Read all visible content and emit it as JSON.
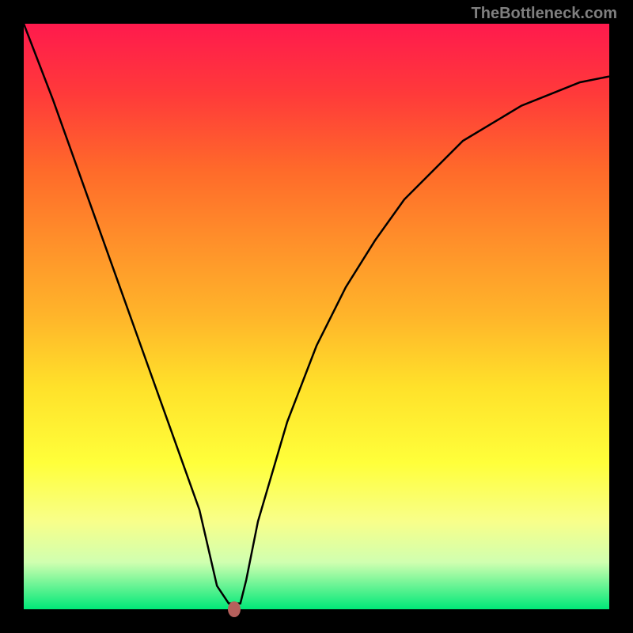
{
  "watermark": "TheBottleneck.com",
  "chart_data": {
    "type": "line",
    "title": "",
    "xlabel": "",
    "ylabel": "",
    "xlim": [
      0,
      100
    ],
    "ylim": [
      0,
      100
    ],
    "background_gradient": {
      "top_color": "#ff1a4d",
      "bottom_color": "#00e878",
      "meaning": "top = high bottleneck (bad / red), bottom = low bottleneck (good / green)"
    },
    "series": [
      {
        "name": "bottleneck-curve",
        "x": [
          0,
          5,
          10,
          15,
          20,
          25,
          30,
          33,
          35,
          37,
          38,
          40,
          45,
          50,
          55,
          60,
          65,
          70,
          75,
          80,
          85,
          90,
          95,
          100
        ],
        "y": [
          100,
          87,
          73,
          59,
          45,
          31,
          17,
          4,
          1,
          1,
          5,
          15,
          32,
          45,
          55,
          63,
          70,
          75,
          80,
          83,
          86,
          88,
          90,
          91
        ]
      }
    ],
    "marker": {
      "name": "optimum-point",
      "x": 36,
      "y": 0,
      "color": "#b5605c"
    }
  }
}
